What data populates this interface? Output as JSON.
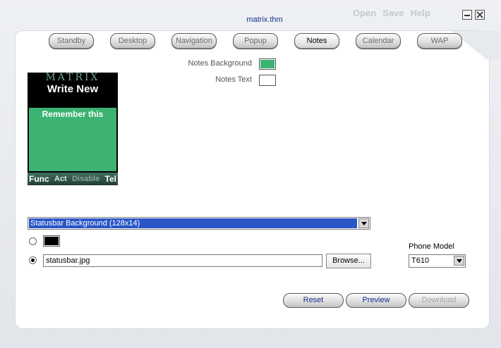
{
  "window": {
    "title": "matrix.thm",
    "menu": [
      "Open",
      "Save",
      "Help"
    ]
  },
  "tabs": [
    {
      "label": "Standby",
      "active": false
    },
    {
      "label": "Desktop",
      "active": false
    },
    {
      "label": "Navigation",
      "active": false
    },
    {
      "label": "Popup",
      "active": false
    },
    {
      "label": "Notes",
      "active": true
    },
    {
      "label": "Calendar",
      "active": false
    },
    {
      "label": "WAP",
      "active": false
    }
  ],
  "preview": {
    "logo": "MATRIX",
    "title": "Write New",
    "note_text": "Remember this",
    "softkeys": {
      "func": "Func",
      "act": "Act",
      "disable": "Disable",
      "tel": "Tel"
    }
  },
  "colors": {
    "notes_background": "#3cb371",
    "notes_text": "#ffffff",
    "statusbar_swatch": "#000000"
  },
  "settings": {
    "notes_background_label": "Notes Background",
    "notes_text_label": "Notes Text"
  },
  "image_element": {
    "selected": "Statusbar Background (128x14)",
    "file_value": "statusbar.jpg",
    "browse_label": "Browse...",
    "selected_radio": "file"
  },
  "phone_model": {
    "label": "Phone Model",
    "value": "T610"
  },
  "actions": {
    "reset": "Reset",
    "preview": "Preview",
    "download": "Download"
  }
}
